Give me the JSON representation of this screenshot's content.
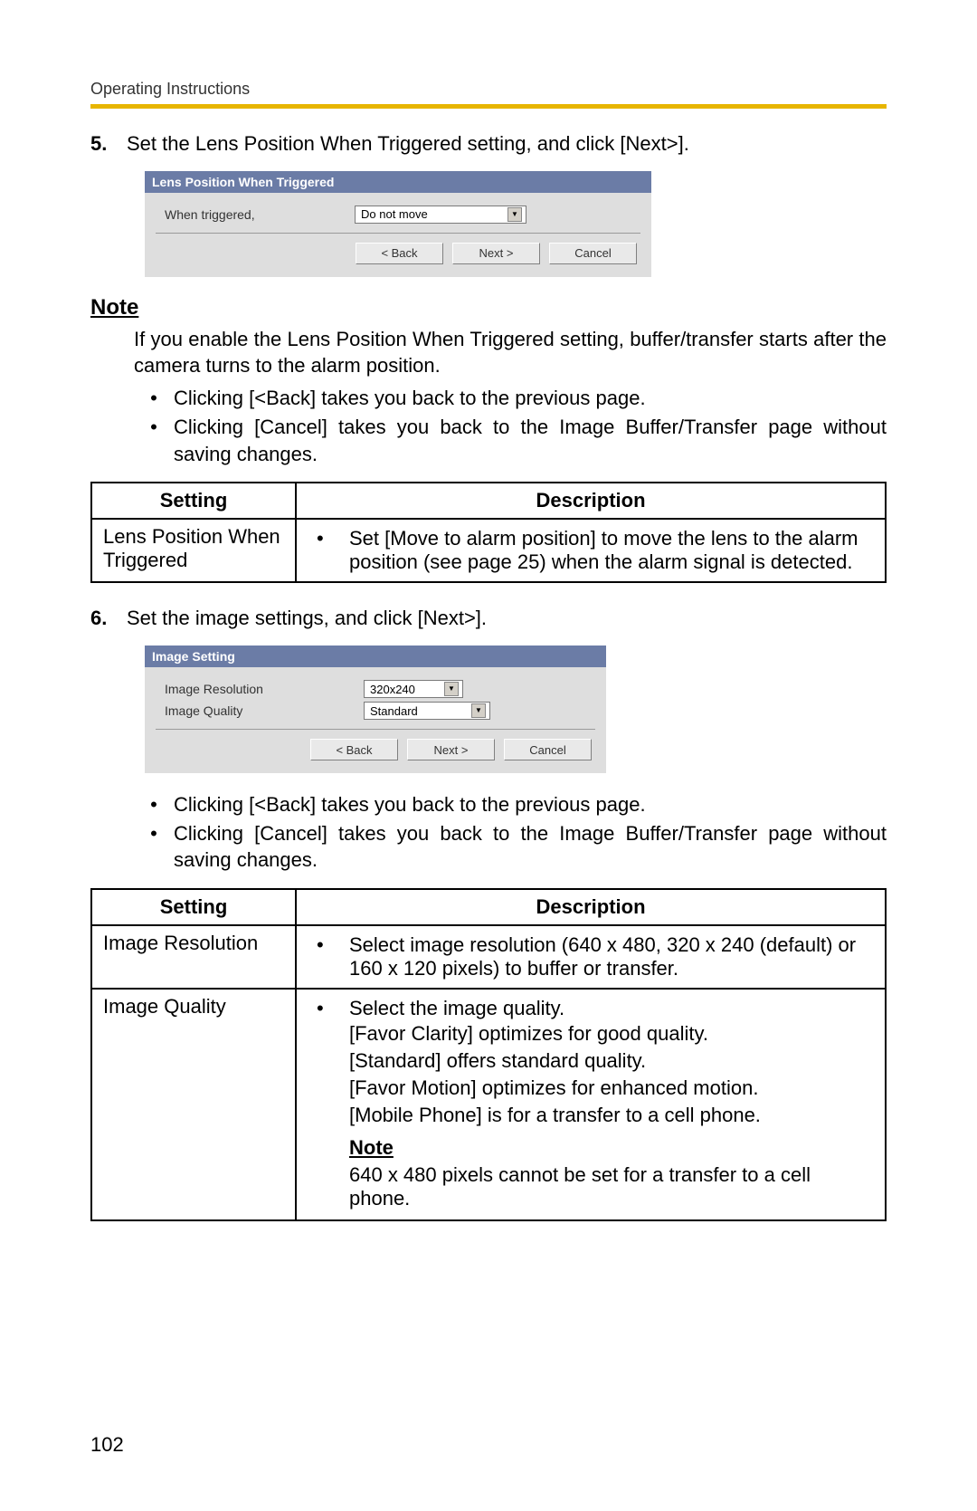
{
  "header": "Operating Instructions",
  "page_number": "102",
  "step5": {
    "num": "5.",
    "text": "Set the Lens Position When Triggered setting, and click [Next>]."
  },
  "shot1": {
    "title": "Lens Position When Triggered",
    "label": "When triggered,",
    "value": "Do not move",
    "back": "< Back",
    "next": "Next >",
    "cancel": "Cancel"
  },
  "note1": {
    "heading": "Note",
    "para": "If you enable the Lens Position When Triggered setting, buffer/transfer starts after the camera turns to the alarm position.",
    "b1": "Clicking [<Back] takes you back to the previous page.",
    "b2": "Clicking [Cancel] takes you back to the Image Buffer/Transfer page without saving changes."
  },
  "table1": {
    "h1": "Setting",
    "h2": "Description",
    "r1c1": "Lens Position When Triggered",
    "r1c2": "Set [Move to alarm position] to move the lens to the alarm position (see page 25) when the alarm signal is detected."
  },
  "step6": {
    "num": "6.",
    "text": "Set the image settings, and click [Next>]."
  },
  "shot2": {
    "title": "Image Setting",
    "l1": "Image Resolution",
    "v1": "320x240",
    "l2": "Image Quality",
    "v2": "Standard",
    "back": "< Back",
    "next": "Next >",
    "cancel": "Cancel"
  },
  "note2": {
    "b1": "Clicking [<Back] takes you back to the previous page.",
    "b2": "Clicking [Cancel] takes you back to the Image Buffer/Transfer page without saving changes."
  },
  "table2": {
    "h1": "Setting",
    "h2": "Description",
    "r1c1": "Image Resolution",
    "r1c2": "Select image resolution (640 x 480, 320 x 240 (default) or 160 x 120 pixels) to buffer or transfer.",
    "r2c1": "Image Quality",
    "r2b1": "Select the image quality.",
    "r2s1": "[Favor Clarity] optimizes for good quality.",
    "r2s2": "[Standard] offers standard quality.",
    "r2s3": "[Favor Motion] optimizes for enhanced motion.",
    "r2s4": "[Mobile Phone] is for a transfer to a cell phone.",
    "r2note": "Note",
    "r2notetext": "640 x 480 pixels cannot be set for a transfer to a cell phone."
  }
}
